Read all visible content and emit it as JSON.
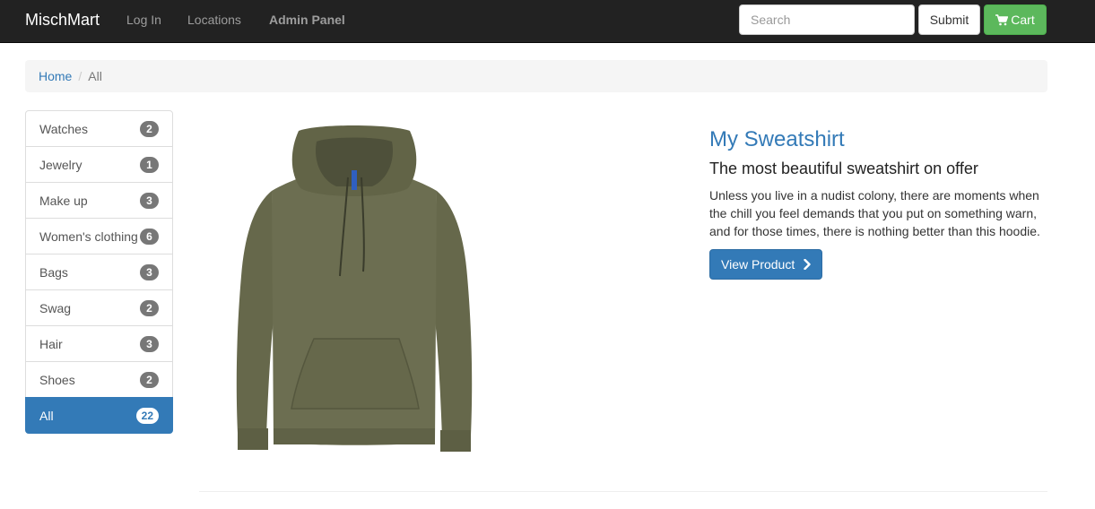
{
  "navbar": {
    "brand": "MischMart",
    "links": [
      "Log In",
      "Locations",
      "Admin Panel"
    ],
    "search_placeholder": "Search",
    "submit_label": "Submit",
    "cart_label": "Cart",
    "cart_icon": "shopping-cart-icon"
  },
  "breadcrumb": {
    "home": "Home",
    "separator": "/",
    "current": "All"
  },
  "categories": [
    {
      "label": "Watches",
      "count": "2"
    },
    {
      "label": "Jewelry",
      "count": "1"
    },
    {
      "label": "Make up",
      "count": "3"
    },
    {
      "label": "Women's clothing",
      "count": "6"
    },
    {
      "label": "Bags",
      "count": "3"
    },
    {
      "label": "Swag",
      "count": "2"
    },
    {
      "label": "Hair",
      "count": "3"
    },
    {
      "label": "Shoes",
      "count": "2"
    },
    {
      "label": "All",
      "count": "22",
      "active": true
    }
  ],
  "product": {
    "title": "My Sweatshirt",
    "subtitle": "The most beautiful sweatshirt on offer",
    "description": "Unless you live in a nudist colony, there are moments when the chill you feel demands that you put on something warn, and for those times, there is nothing better than this hoodie.",
    "view_label": "View Product",
    "view_icon": "chevron-right-icon",
    "image_icon": "hoodie-image"
  },
  "colors": {
    "navbar_bg": "#222222",
    "primary": "#337ab7",
    "success": "#5cb85c",
    "hoodie": "#6b6b4e"
  }
}
